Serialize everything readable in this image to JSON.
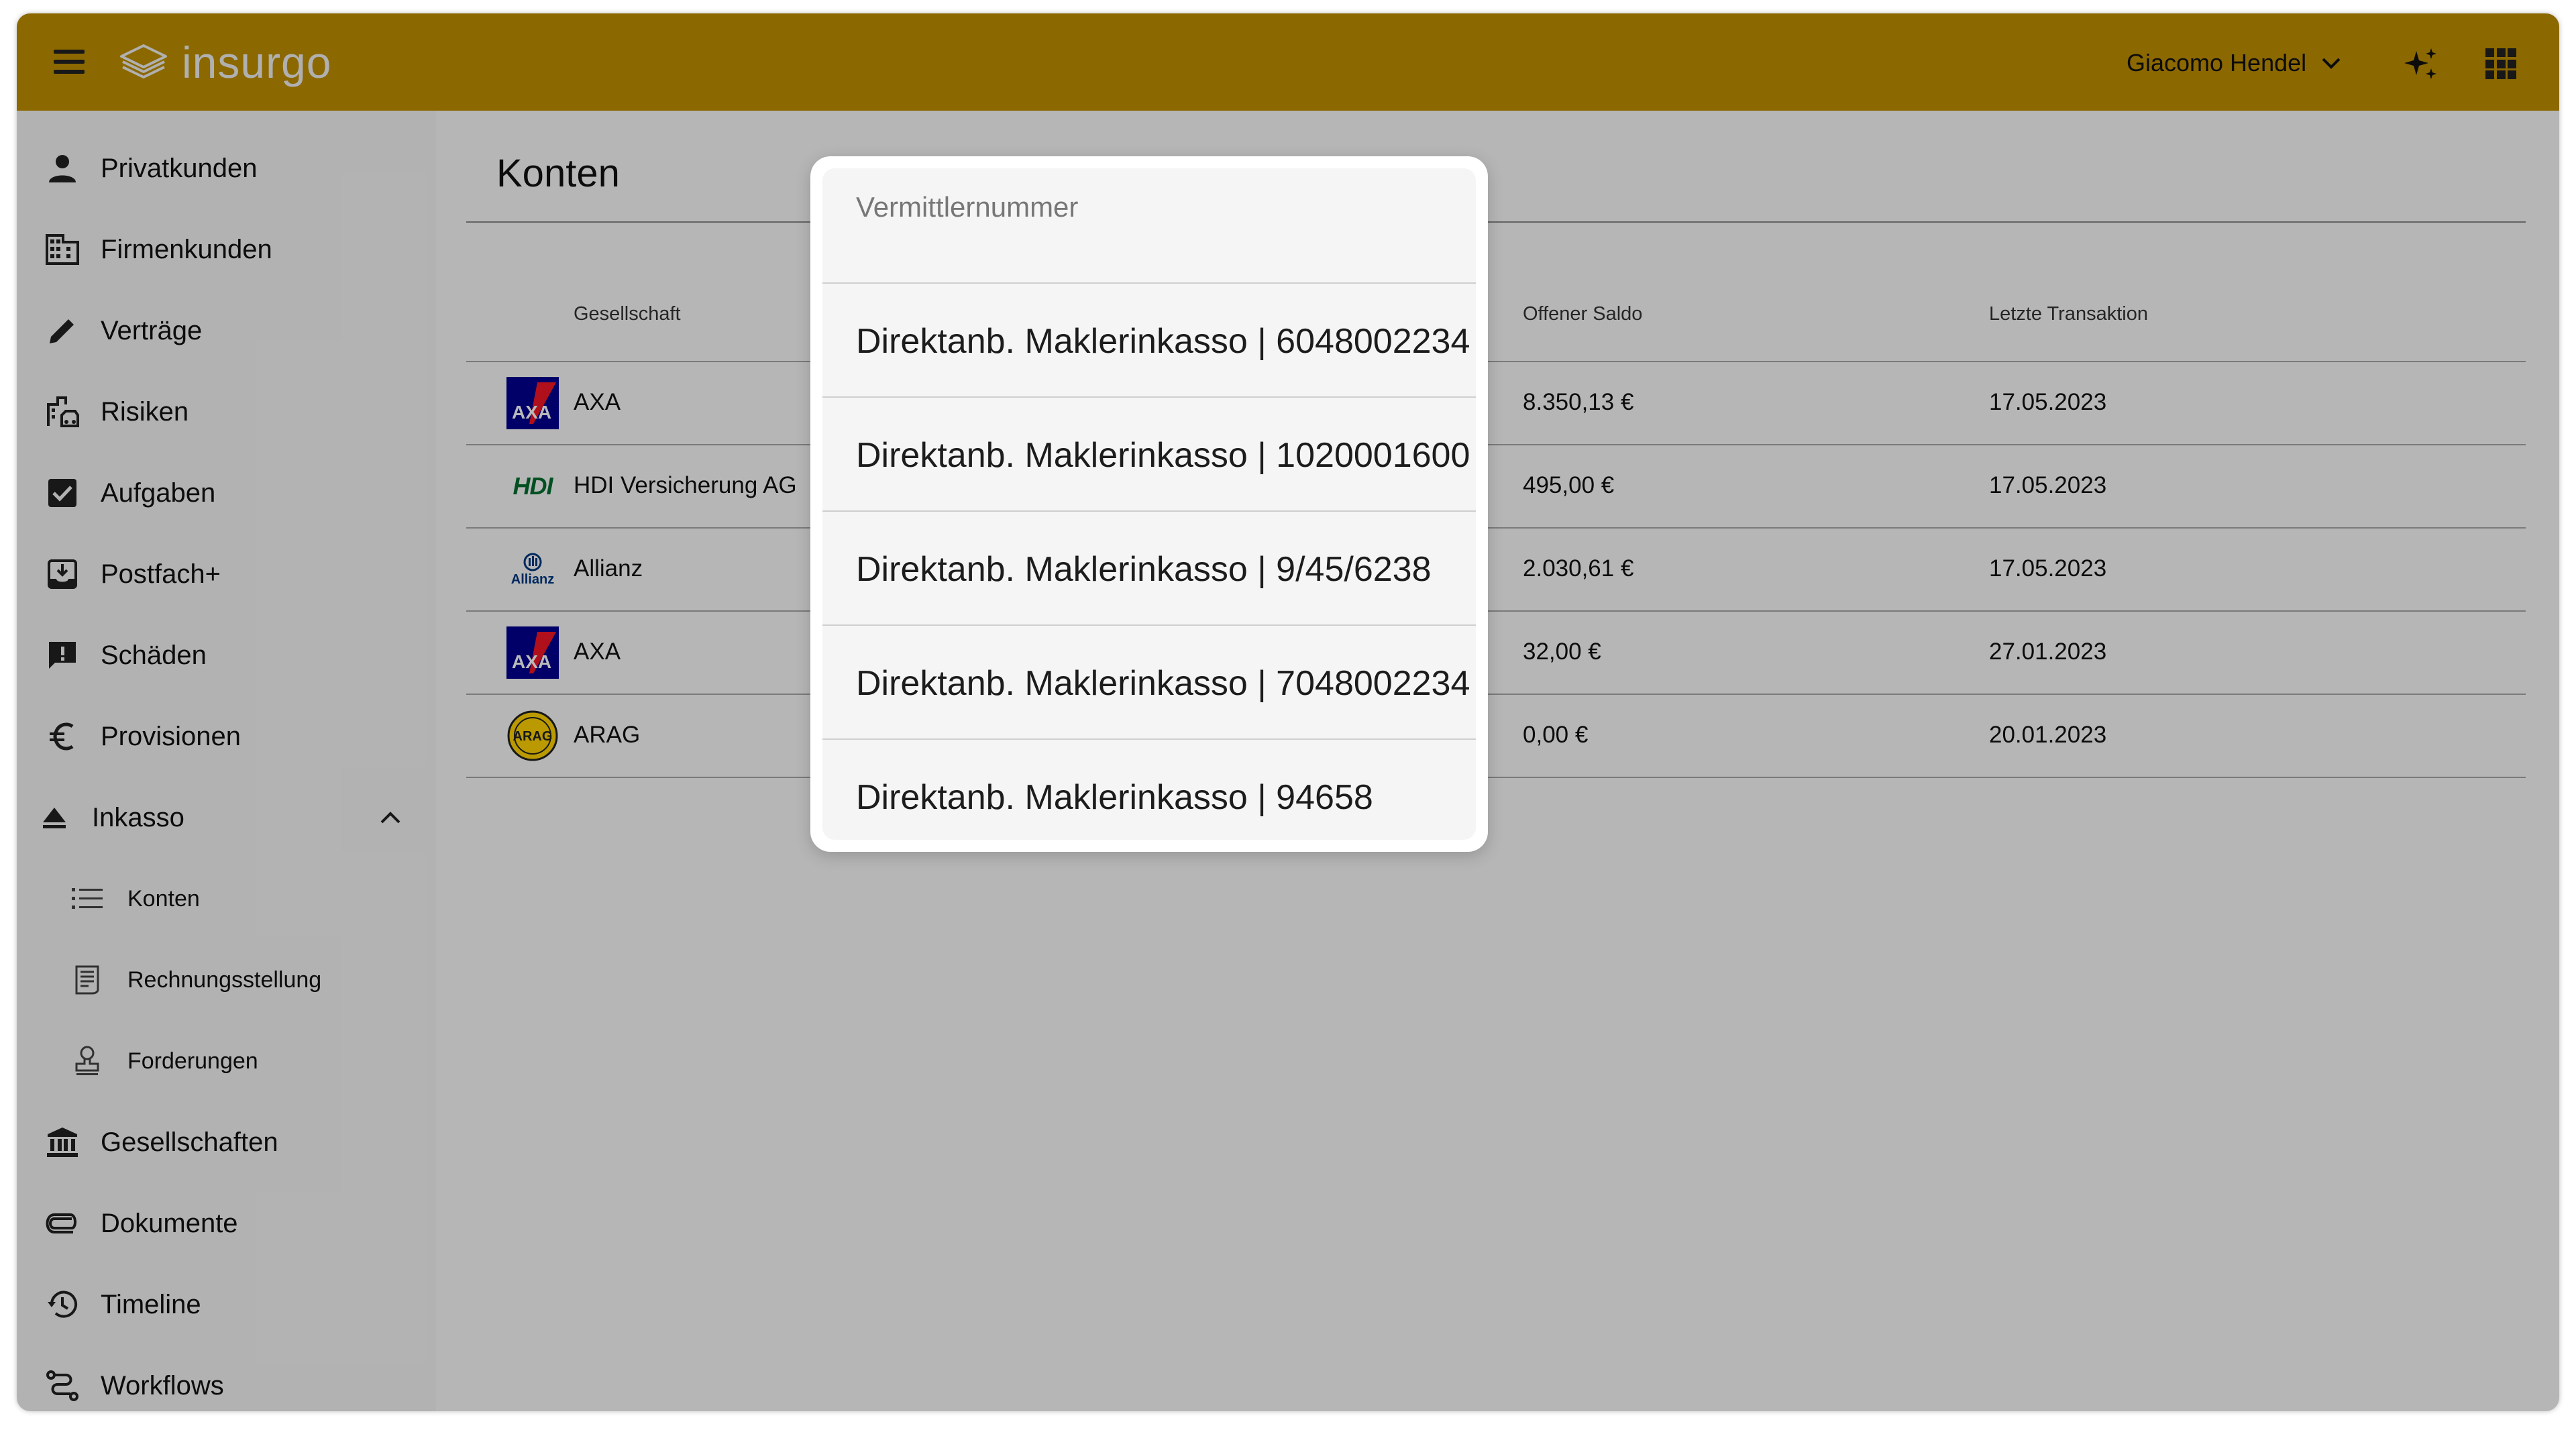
{
  "colors": {
    "topbar": "#bf8f00",
    "sidebar": "#f5f5f5",
    "main_bg": "#fafafa",
    "overlay": "rgba(0,0,0,0.27)"
  },
  "header": {
    "logo_text": "insurgo",
    "user_name": "Giacomo Hendel"
  },
  "sidebar": {
    "items": [
      {
        "label": "Privatkunden",
        "icon": "person-icon"
      },
      {
        "label": "Firmenkunden",
        "icon": "building-icon"
      },
      {
        "label": "Verträge",
        "icon": "pencil-icon"
      },
      {
        "label": "Risiken",
        "icon": "risk-icon"
      },
      {
        "label": "Aufgaben",
        "icon": "checkbox-icon"
      },
      {
        "label": "Postfach+",
        "icon": "inbox-icon"
      },
      {
        "label": "Schäden",
        "icon": "alert-chat-icon"
      },
      {
        "label": "Provisionen",
        "icon": "euro-icon"
      },
      {
        "label": "Inkasso",
        "icon": "eject-icon"
      },
      {
        "label": "Konten",
        "icon": "list-icon"
      },
      {
        "label": "Rechnungsstellung",
        "icon": "receipt-icon"
      },
      {
        "label": "Forderungen",
        "icon": "stamp-icon"
      },
      {
        "label": "Gesellschaften",
        "icon": "bank-icon"
      },
      {
        "label": "Dokumente",
        "icon": "paperclip-icon"
      },
      {
        "label": "Timeline",
        "icon": "history-icon"
      },
      {
        "label": "Workflows",
        "icon": "workflow-icon"
      }
    ]
  },
  "main": {
    "title": "Konten",
    "table": {
      "headers": [
        "Gesellschaft",
        "Offener Saldo",
        "Letzte Transaktion"
      ],
      "rows": [
        {
          "company": "AXA",
          "balance": "8.350,13 €",
          "date": "17.05.2023",
          "logo": "axa-logo"
        },
        {
          "company": "HDI Versicherung AG",
          "balance": "495,00 €",
          "date": "17.05.2023",
          "logo": "hdi-logo"
        },
        {
          "company": "Allianz",
          "balance": "2.030,61 €",
          "date": "17.05.2023",
          "logo": "allianz-logo"
        },
        {
          "company": "AXA",
          "balance": "32,00 €",
          "date": "27.01.2023",
          "logo": "axa-logo"
        },
        {
          "company": "ARAG",
          "balance": "0,00 €",
          "date": "20.01.2023",
          "logo": "arag-logo"
        }
      ]
    }
  },
  "dropdown": {
    "header": "Vermittlernummer",
    "options": [
      "Direktanb. Maklerinkasso | 6048002234",
      "Direktanb. Maklerinkasso | 1020001600",
      "Direktanb. Maklerinkasso | 9/45/6238",
      "Direktanb. Maklerinkasso | 7048002234",
      "Direktanb. Maklerinkasso | 94658"
    ]
  },
  "logos": {
    "hdi": "HDI",
    "allianz": "Allianz",
    "arag": "ARAG",
    "axa": "AXA"
  }
}
